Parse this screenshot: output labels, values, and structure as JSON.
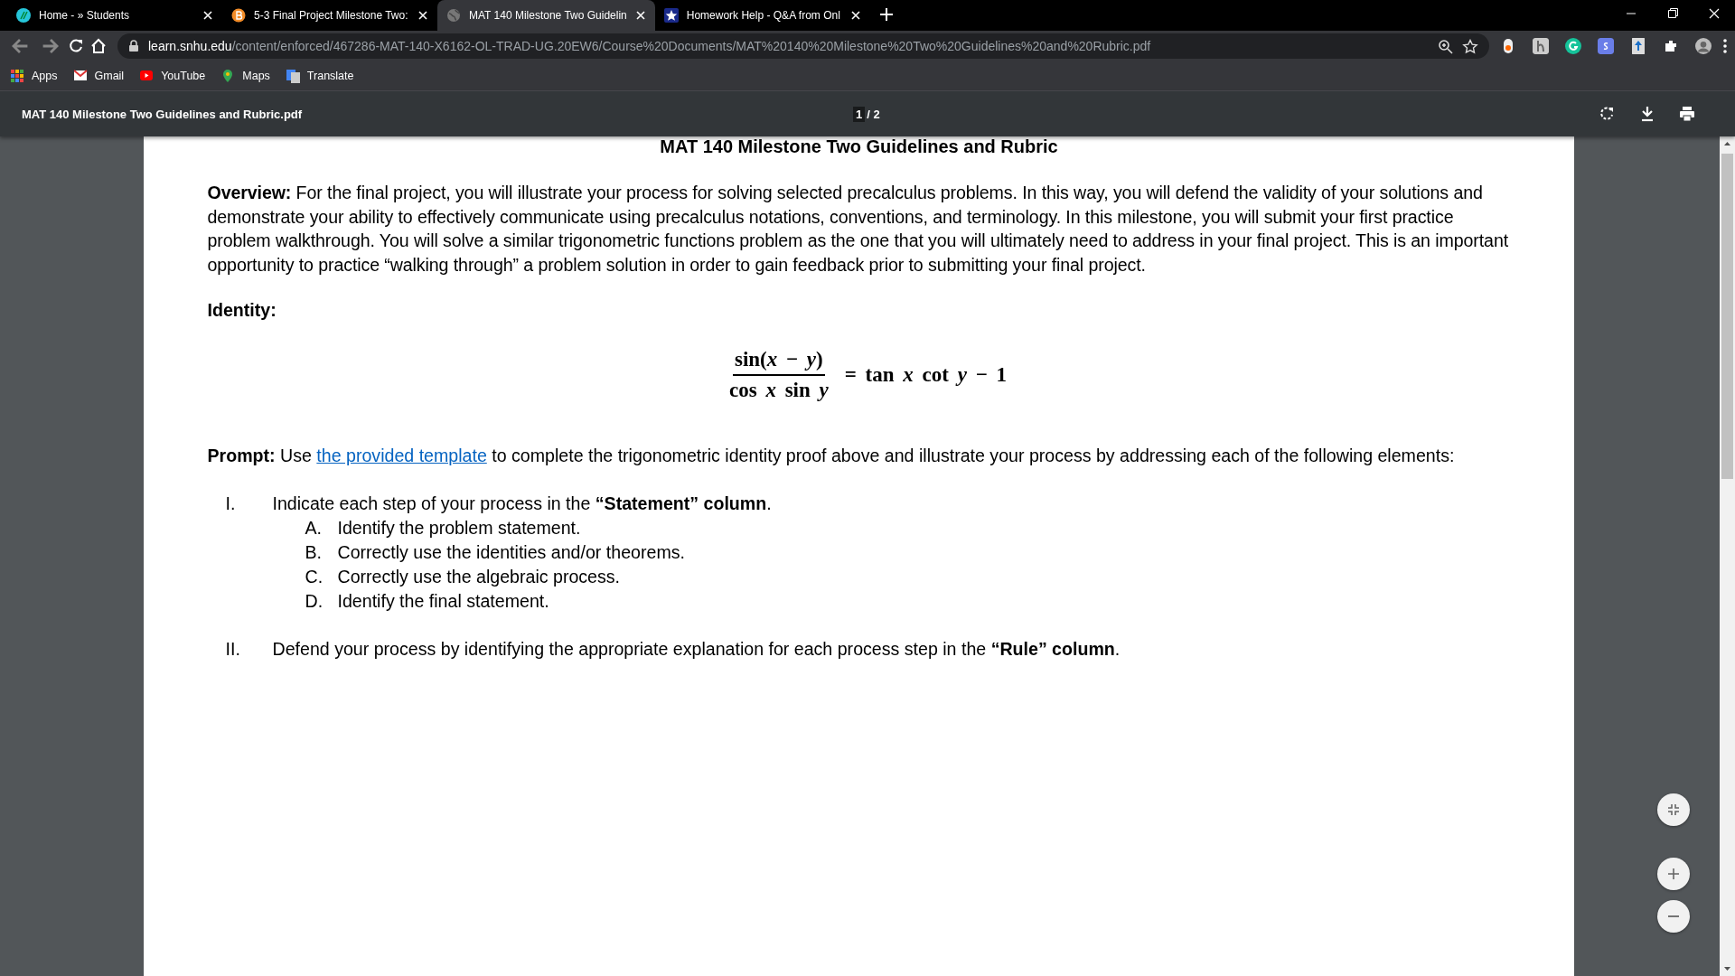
{
  "tabs": [
    {
      "kind": "swirl",
      "title": "Home - » Students",
      "selected": false
    },
    {
      "kind": "coin",
      "title": "5-3 Final Project Milestone Two:",
      "selected": false
    },
    {
      "kind": "globe",
      "title": "MAT 140 Milestone Two Guidelin",
      "selected": true
    },
    {
      "kind": "star",
      "title": "Homework Help - Q&A from Onl",
      "selected": false
    }
  ],
  "address": {
    "domain": "learn.snhu.edu",
    "path": "/content/enforced/467286-MAT-140-X6162-OL-TRAD-UG.20EW6/Course%20Documents/MAT%20140%20Milestone%20Two%20Guidelines%20and%20Rubric.pdf"
  },
  "bookmarks": [
    {
      "kind": "apps",
      "label": "Apps"
    },
    {
      "kind": "mail",
      "label": "Gmail"
    },
    {
      "kind": "video",
      "label": "YouTube"
    },
    {
      "kind": "pin",
      "label": "Maps"
    },
    {
      "kind": "translate",
      "label": "Translate"
    }
  ],
  "pdf_toolbar": {
    "title": "MAT 140 Milestone Two Guidelines and Rubric.pdf",
    "page": "1",
    "total": "/ 2"
  },
  "document": {
    "title": "MAT 140 Milestone Two Guidelines and Rubric",
    "overview": "**Overview:** For the final project, you will illustrate your process for solving selected precalculus problems. In this way, you will defend the validity of your solutions and demonstrate your ability to effectively communicate using precalculus notations, conventions, and terminology. In this milestone, you will submit your first practice problem walkthrough. You will solve a similar trigonometric functions problem as the one that you will ultimately need to address in your final project. This is an important opportunity to practice “walking through” a problem solution in order to gain feedback prior to submitting your final project.",
    "identity_heading": "Identity:",
    "equation": {
      "numerator": "sin(*x* − *y*)",
      "denominator": "cos *x*  sin *y*",
      "right": "=  tan *x*  cot *y* − 1"
    },
    "prompt": {
      "before": "**Prompt:** Use",
      "link": "the provided template",
      "after": "to complete the trigonometric identity proof above and illustrate your process by addressing each of the following elements:"
    },
    "items": [
      {
        "numeral": "I.",
        "text": "Indicate each step of your process in the **“Statement” column**.",
        "children": [
          {
            "letter": "A.",
            "text": "Identify the problem statement."
          },
          {
            "letter": "B.",
            "text": "Correctly use the identities and/or theorems."
          },
          {
            "letter": "C.",
            "text": "Correctly use the algebraic process."
          },
          {
            "letter": "D.",
            "text": "Identify the final statement."
          }
        ]
      },
      {
        "numeral": "II.",
        "text": "Defend your process by identifying the appropriate explanation for each process step in the **“Rule” column**."
      }
    ]
  }
}
